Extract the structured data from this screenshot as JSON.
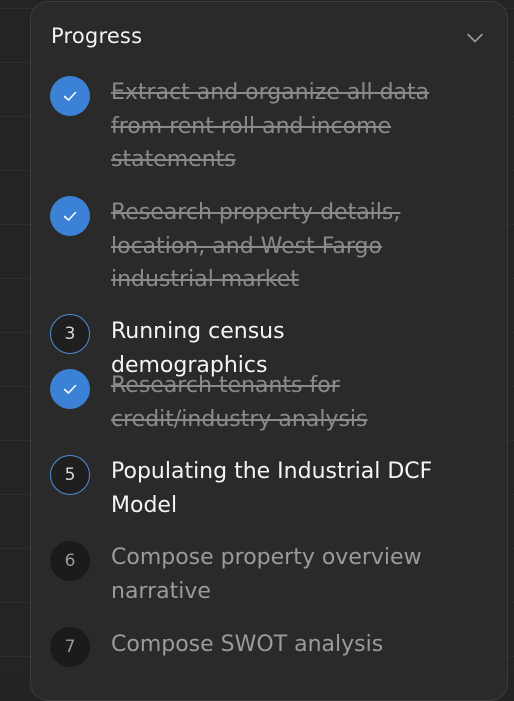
{
  "panel": {
    "title": "Progress",
    "collapse_icon": "chevron-down-icon"
  },
  "colors": {
    "done": "#3b82d6",
    "active_border": "#4a8ed8",
    "panel_bg": "#2a2a2a"
  },
  "steps": [
    {
      "status": "done",
      "icon": "check-icon",
      "label": "Extract and organize all data from rent roll and income statements"
    },
    {
      "status": "done",
      "icon": "check-icon",
      "label": "Research property details, location, and West Fargo industrial market"
    },
    {
      "status": "active",
      "number": "3",
      "label": "Running census demographics"
    },
    {
      "status": "done",
      "icon": "check-icon",
      "label": "Research tenants for credit/industry analysis"
    },
    {
      "status": "active",
      "number": "5",
      "label": "Populating the Industrial DCF Model"
    },
    {
      "status": "pending",
      "number": "6",
      "label": "Compose property overview narrative"
    },
    {
      "status": "pending",
      "number": "7",
      "label": "Compose SWOT analysis"
    }
  ]
}
